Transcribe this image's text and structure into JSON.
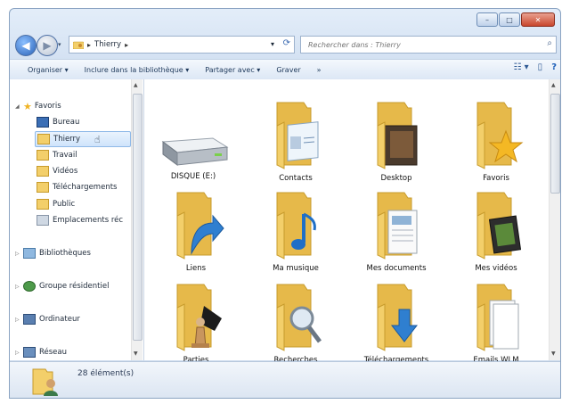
{
  "window": {
    "buttons": {
      "minimize": "–",
      "maximize": "□",
      "close": "✕"
    }
  },
  "address": {
    "crumbs": [
      "Thierry"
    ],
    "search_placeholder": "Rechercher dans : Thierry"
  },
  "toolbar": {
    "items": [
      "Organiser ▾",
      "Inclure dans la bibliothèque ▾",
      "Partager avec ▾",
      "Graver",
      "»"
    ]
  },
  "nav": {
    "favorites_label": "Favoris",
    "favorites": [
      "Bureau",
      "Thierry",
      "Travail",
      "Vidéos",
      "Téléchargements",
      "Public",
      "Emplacements réc"
    ],
    "selected": "Thierry",
    "groups": [
      "Bibliothèques",
      "Groupe résidentiel",
      "Ordinateur",
      "Réseau"
    ]
  },
  "content": {
    "items": [
      "DISQUE (E:)",
      "Contacts",
      "Desktop",
      "Favoris",
      "Liens",
      "Ma musique",
      "Mes documents",
      "Mes vidéos",
      "Parties",
      "Recherches",
      "Téléchargements",
      "Emails WLM"
    ]
  },
  "status": {
    "count_label": "28 élément(s)"
  },
  "colors": {
    "folder": "#f3cf6a",
    "accent": "#2a62b8",
    "selection": "#cfe4fb"
  }
}
